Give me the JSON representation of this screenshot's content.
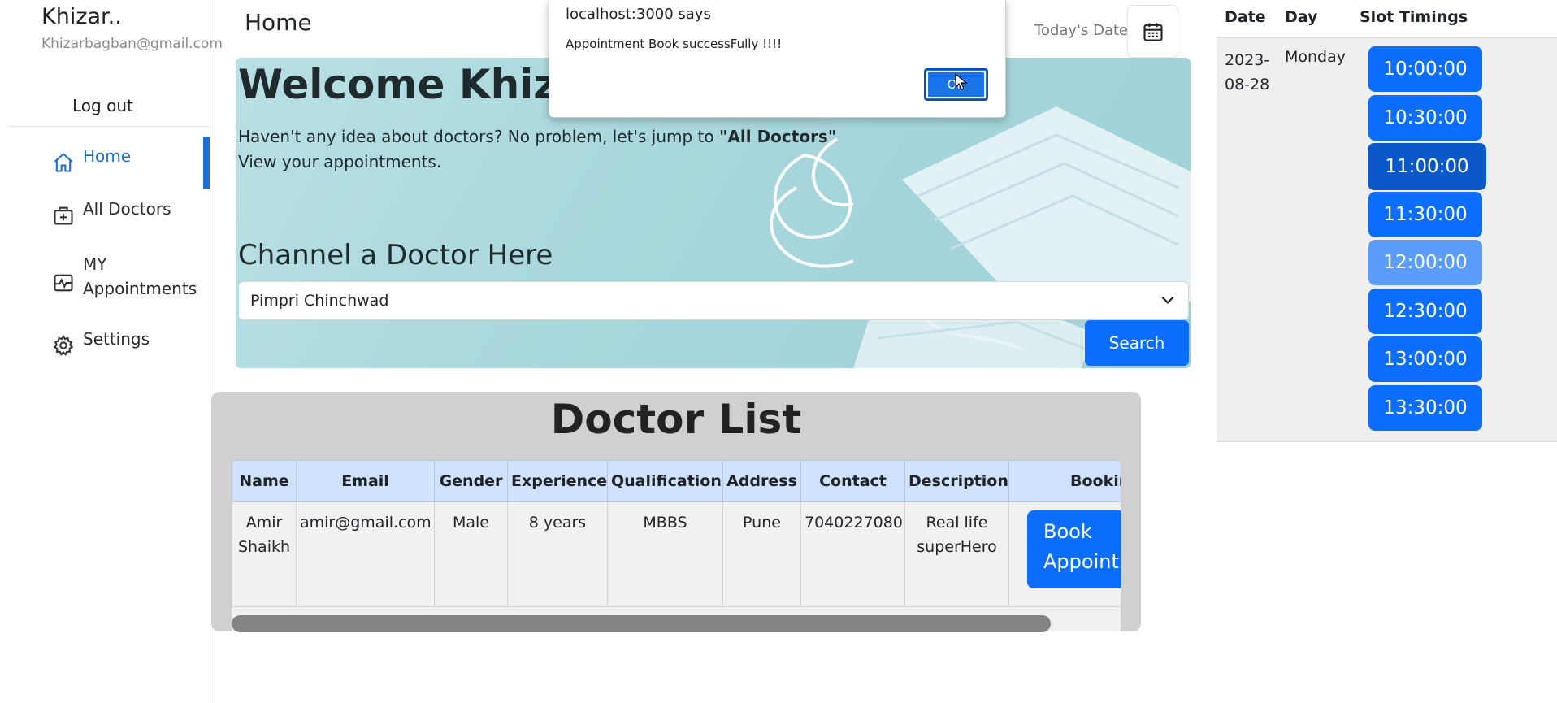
{
  "sidebar": {
    "user_name": "Khizar..",
    "user_email": "Khizarbagban@gmail.com",
    "logout_label": "Log out",
    "items": [
      {
        "label": "Home",
        "icon": "home-icon",
        "active": true
      },
      {
        "label": "All Doctors",
        "icon": "medical-bag-icon"
      },
      {
        "label": "MY Appointments",
        "line1": "MY",
        "line2": "Appointments",
        "icon": "heartbeat-icon"
      },
      {
        "label": "Settings",
        "icon": "gear-icon"
      }
    ]
  },
  "header": {
    "title": "Home",
    "todays_date_label": "Today's Date",
    "calendar_icon": "calendar-icon"
  },
  "hero": {
    "welcome": "Welcome Khizar",
    "intro_text": "Haven't any idea about doctors? No problem, let's jump to ",
    "intro_bold": "\"All Doctors\"",
    "intro_line2": "View your appointments.",
    "channel_heading": "Channel a Doctor Here",
    "selected_city": "Pimpri Chinchwad",
    "search_label": "Search"
  },
  "doctor_list": {
    "title": "Doctor List",
    "columns": [
      "Name",
      "Email",
      "Gender",
      "Experience",
      "Qualification",
      "Address",
      "Contact",
      "Description",
      "Booking"
    ],
    "rows": [
      {
        "name": "Amir Shaikh",
        "email": "amir@gmail.com",
        "gender": "Male",
        "experience": "8 years",
        "qualification": "MBBS",
        "address": "Pune",
        "contact": "7040227080",
        "description": "Real life superHero",
        "book_label_line1": "Book",
        "book_label_line2": "Appointment"
      }
    ]
  },
  "slots": {
    "headers": [
      "Date",
      "Day",
      "Slot Timings"
    ],
    "date_line1": "2023-",
    "date_line2": "08-28",
    "day": "Monday",
    "times": [
      "10:00:00",
      "10:30:00",
      "11:00:00",
      "11:30:00",
      "12:00:00",
      "12:30:00",
      "13:00:00",
      "13:30:00"
    ],
    "selected": "11:00:00",
    "hovered": "12:00:00"
  },
  "alert": {
    "origin": "localhost:3000 says",
    "message": "Appointment Book successFully !!!!",
    "ok_label": "OK"
  },
  "colors": {
    "primary": "#0d6efd",
    "primary_selected": "#0a58ca",
    "primary_hover": "#5b9dfa",
    "sidebar_active": "#1f6fd8",
    "table_header": "#cfe2ff",
    "card_bg": "#d0d0d0"
  }
}
